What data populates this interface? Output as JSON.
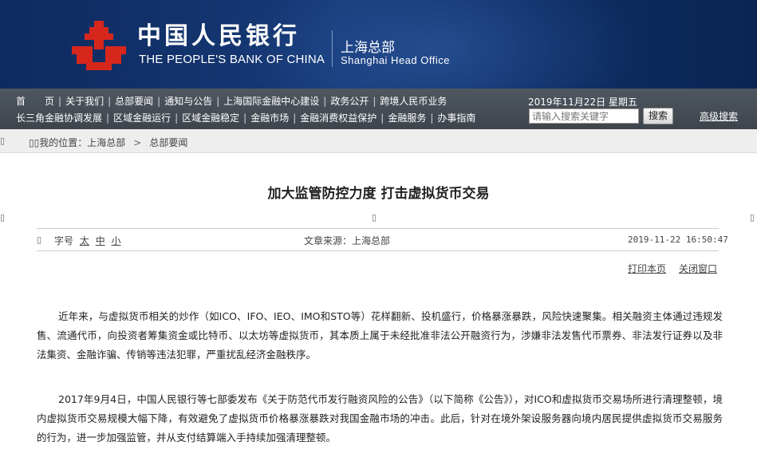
{
  "header": {
    "cn_name": "中国人民银行",
    "en_name": "THE PEOPLE'S BANK OF CHINA",
    "office_cn": "上海总部",
    "office_en": "Shanghai Head Office",
    "logo_icon": "pboc-logo-icon",
    "logo_color": "#d7261c"
  },
  "nav": {
    "row1": [
      "首　　页",
      "关于我们",
      "总部要闻",
      "通知与公告",
      "上海国际金融中心建设",
      "政务公开",
      "跨境人民币业务"
    ],
    "row2": [
      "长三角金融协调发展",
      "区域金融运行",
      "区域金融稳定",
      "金融市场",
      "金融消费权益保护",
      "金融服务",
      "办事指南"
    ],
    "date": "2019年11月22日 星期五",
    "search_placeholder": "请输入搜索关键字",
    "search_button": "搜索",
    "advanced_search": "高级搜索"
  },
  "breadcrumb": {
    "glyph": "▯▯",
    "prefix": "我的位置：",
    "items": [
      "上海总部",
      "总部要闻"
    ],
    "separator": ">"
  },
  "article": {
    "title": "加大监管防控力度 打击虚拟货币交易",
    "glyph": "▯",
    "font_size_label": "字号",
    "font_sizes": [
      "太",
      "中",
      "小"
    ],
    "source": "文章来源：上海总部",
    "datetime": "2019-11-22  16:50:47",
    "print_label": "打印本页",
    "close_label": "关闭窗口",
    "paragraphs": [
      "近年来，与虚拟货币相关的炒作（如ICO、IFO、IEO、IMO和STO等）花样翻新、投机盛行，价格暴涨暴跌，风险快速聚集。相关融资主体通过违规发售、流通代币，向投资者筹集资金或比特币、以太坊等虚拟货币，其本质上属于未经批准非法公开融资行为，涉嫌非法发售代币票券、非法发行证券以及非法集资、金融诈骗、传销等违法犯罪，严重扰乱经济金融秩序。",
      "2017年9月4日，中国人民银行等七部委发布《关于防范代币发行融资风险的公告》（以下简称《公告》），对ICO和虚拟货币交易场所进行清理整顿，境内虚拟货币交易规模大幅下降，有效避免了虚拟货币价格暴涨暴跌对我国金融市场的冲击。此后，针对在境外架设服务器向境内居民提供虚拟货币交易服务的行为，进一步加强监管，并从支付结算端入手持续加强清理整顿。"
    ]
  }
}
